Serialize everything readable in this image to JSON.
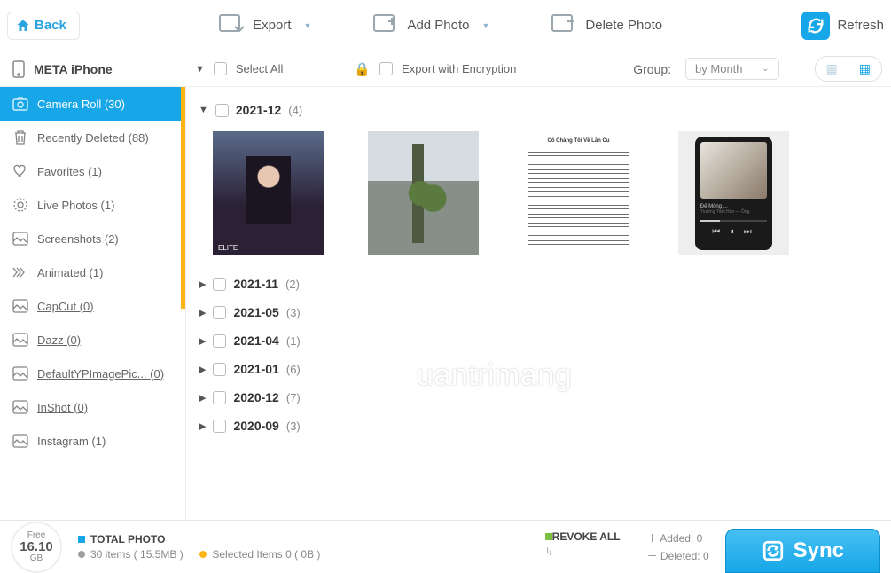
{
  "topbar": {
    "back_label": "Back",
    "export_label": "Export",
    "add_photo_label": "Add Photo",
    "delete_photo_label": "Delete Photo",
    "refresh_label": "Refresh"
  },
  "subbar": {
    "device_name": "META iPhone",
    "select_all_label": "Select All",
    "export_encryption_label": "Export with Encryption",
    "group_label": "Group:",
    "group_value": "by Month"
  },
  "sidebar": {
    "items": [
      {
        "icon": "camera",
        "label": "Camera Roll (30)",
        "active": true,
        "underlined": false
      },
      {
        "icon": "trash",
        "label": "Recently Deleted (88)",
        "active": false,
        "underlined": false
      },
      {
        "icon": "heart",
        "label": "Favorites (1)",
        "active": false,
        "underlined": false
      },
      {
        "icon": "live",
        "label": "Live Photos (1)",
        "active": false,
        "underlined": false
      },
      {
        "icon": "image",
        "label": "Screenshots (2)",
        "active": false,
        "underlined": false
      },
      {
        "icon": "burst",
        "label": "Animated (1)",
        "active": false,
        "underlined": false
      },
      {
        "icon": "image",
        "label": "CapCut (0)",
        "active": false,
        "underlined": true
      },
      {
        "icon": "image",
        "label": "Dazz (0)",
        "active": false,
        "underlined": true
      },
      {
        "icon": "image",
        "label": "DefaultYPImagePic... (0)",
        "active": false,
        "underlined": true
      },
      {
        "icon": "image",
        "label": "InShot (0)",
        "active": false,
        "underlined": true
      },
      {
        "icon": "image",
        "label": "Instagram (1)",
        "active": false,
        "underlined": false
      }
    ]
  },
  "groups": [
    {
      "label": "2021-12",
      "count": "(4)",
      "open": true
    },
    {
      "label": "2021-11",
      "count": "(2)",
      "open": false
    },
    {
      "label": "2021-05",
      "count": "(3)",
      "open": false
    },
    {
      "label": "2021-04",
      "count": "(1)",
      "open": false
    },
    {
      "label": "2021-01",
      "count": "(6)",
      "open": false
    },
    {
      "label": "2020-12",
      "count": "(7)",
      "open": false
    },
    {
      "label": "2020-09",
      "count": "(3)",
      "open": false
    }
  ],
  "footer": {
    "free_label": "Free",
    "free_value": "16.10",
    "free_unit": "GB",
    "total_photo_label": "TOTAL PHOTO",
    "total_items": "30 items ( 15.5MB )",
    "selected_items": "Selected Items 0 ( 0B )",
    "revoke_all": "REVOKE ALL",
    "added": "Added: 0",
    "deleted": "Deleted: 0",
    "sync_label": "Sync"
  },
  "watermark": "uantrimang"
}
